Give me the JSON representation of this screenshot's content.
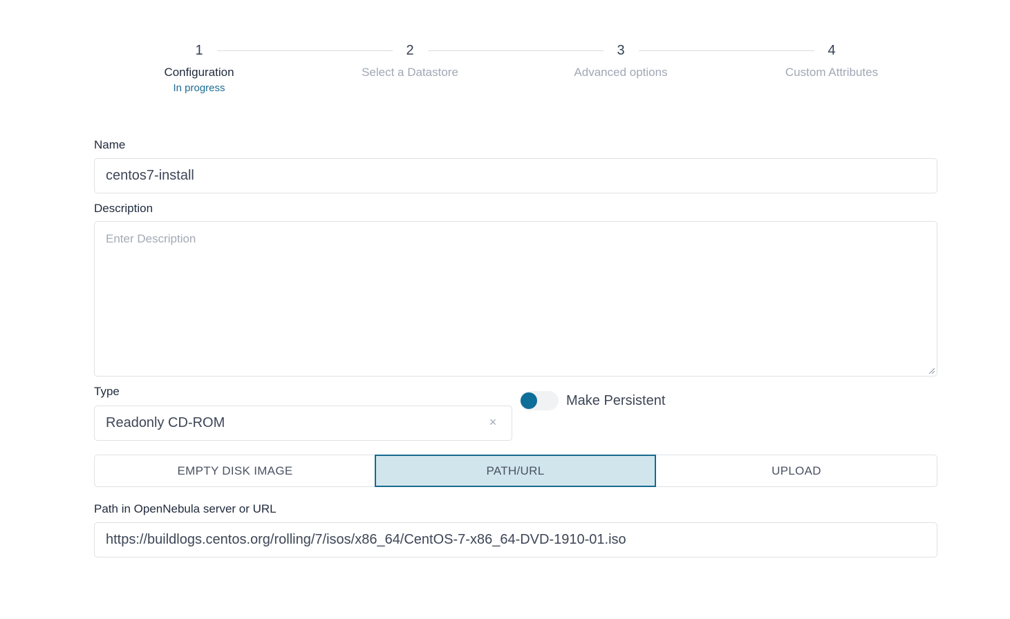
{
  "stepper": {
    "steps": [
      {
        "number": "1",
        "label": "Configuration",
        "status": "In progress",
        "active": true
      },
      {
        "number": "2",
        "label": "Select a Datastore",
        "active": false
      },
      {
        "number": "3",
        "label": "Advanced options",
        "active": false
      },
      {
        "number": "4",
        "label": "Custom Attributes",
        "active": false
      }
    ]
  },
  "form": {
    "name": {
      "label": "Name",
      "value": "centos7-install"
    },
    "description": {
      "label": "Description",
      "value": "",
      "placeholder": "Enter Description"
    },
    "type": {
      "label": "Type",
      "value": "Readonly CD-ROM",
      "clear_icon": "×"
    },
    "persistent": {
      "label": "Make Persistent",
      "checked": false
    },
    "source_tabs": {
      "options": [
        "EMPTY DISK IMAGE",
        "PATH/URL",
        "UPLOAD"
      ],
      "selected": "PATH/URL"
    },
    "path": {
      "label": "Path in OpenNebula server or URL",
      "value": "https://buildlogs.centos.org/rolling/7/isos/x86_64/CentOS-7-x86_64-DVD-1910-01.iso"
    }
  },
  "colors": {
    "accent": "#0d6e98",
    "selected_tab_bg": "#d1e5ed",
    "selected_tab_border": "#17698f",
    "status_text": "#1b6c93"
  },
  "icons": {
    "clear": "close-icon",
    "textarea_resize": "resize-grip-icon"
  }
}
